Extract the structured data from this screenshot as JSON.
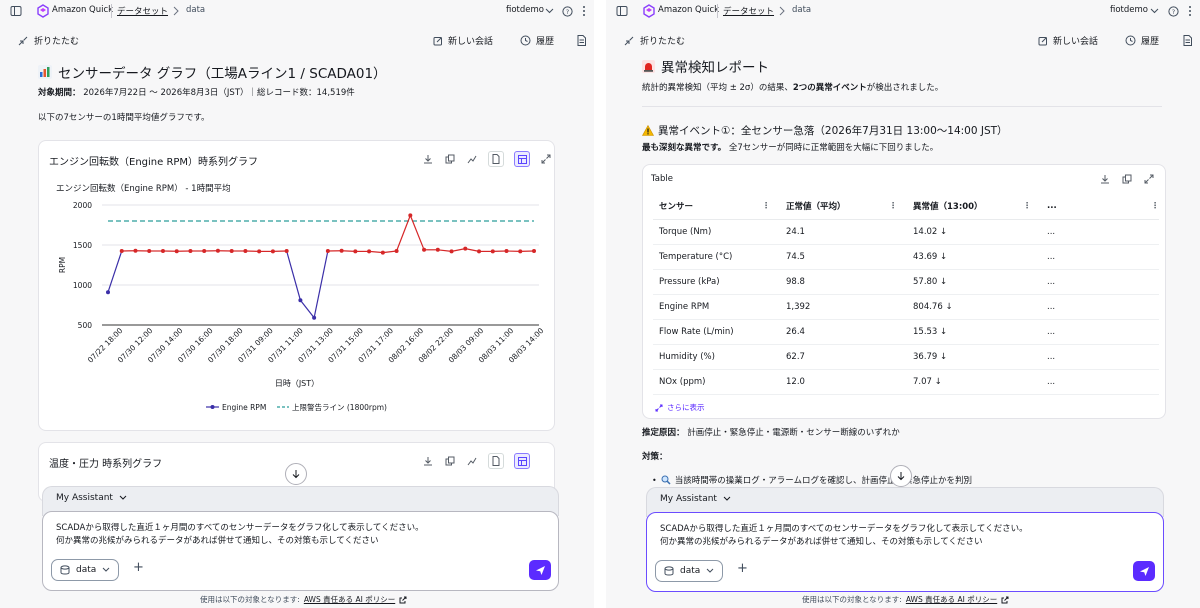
{
  "topbar": {
    "app_name": "Amazon Quick",
    "breadcrumb_dataset": "データセット",
    "breadcrumb_data": "data",
    "user": "fiotdemo"
  },
  "actions": {
    "collapse": "折りたたむ",
    "new_chat": "新しい会話",
    "history": "履歴"
  },
  "left": {
    "heading": "センサーデータ グラフ（工場Aライン1 / SCADA01）",
    "period_label": "対象期間：",
    "period_value": " 2026年7月22日 〜 2026年8月3日（JST）｜総レコード数：14,519件",
    "intro": "以下の7センサーの1時間平均値グラフです。",
    "card1_title": "エンジン回転数（Engine RPM）時系列グラフ",
    "card2_title": "温度・圧力 時系列グラフ"
  },
  "chart_data": {
    "type": "line",
    "title": "エンジン回転数（Engine RPM） - 1時間平均",
    "xlabel": "日時（JST）",
    "ylabel": "RPM",
    "ylim": [
      500,
      2000
    ],
    "yticks": [
      500,
      1000,
      1500,
      2000
    ],
    "xticks": [
      "07/22 18:00",
      "07/30 12:00",
      "07/30 14:00",
      "07/30 16:00",
      "07/30 18:00",
      "07/31 09:00",
      "07/31 11:00",
      "07/31 13:00",
      "07/31 15:00",
      "07/31 17:00",
      "08/02 16:00",
      "08/02 22:00",
      "08/03 09:00",
      "08/03 11:00",
      "08/03 14:00"
    ],
    "series": [
      {
        "name": "Engine RPM",
        "color": "#d62728",
        "values": [
          910,
          1425,
          1428,
          1425,
          1425,
          1422,
          1425,
          1425,
          1428,
          1425,
          1425,
          1420,
          1420,
          1425,
          810,
          590,
          1425,
          1428,
          1420,
          1420,
          1405,
          1425,
          1870,
          1440,
          1440,
          1420,
          1455,
          1420,
          1420,
          1425,
          1420,
          1425
        ]
      },
      {
        "name": "上限警告ライン (1800rpm)",
        "color": "#2a9d9b",
        "values": [
          1800
        ]
      }
    ],
    "anomaly_color": "#3b2fa8",
    "grid": true,
    "legend": "bottom"
  },
  "right": {
    "heading": "異常検知レポート",
    "summary_pre": "統計的異常検知（平均 ± 2σ）の結果、",
    "summary_bold": "2つの異常イベント",
    "summary_post": "が検出されました。",
    "event_title": "異常イベント①：全センサー急落（2026年7月31日 13:00〜14:00 JST）",
    "event_bold": "最も深刻な異常です。",
    "event_text": " 全7センサーが同時に正常範囲を大幅に下回りました。",
    "table_title": "Table",
    "columns": [
      "センサー",
      "正常値（平均）",
      "異常値（13:00）",
      "..."
    ],
    "rows": [
      [
        "Torque (Nm)",
        "24.1",
        "14.02 ↓",
        "..."
      ],
      [
        "Temperature (°C)",
        "74.5",
        "43.69 ↓",
        "..."
      ],
      [
        "Pressure (kPa)",
        "98.8",
        "57.80 ↓",
        "..."
      ],
      [
        "Engine RPM",
        "1,392",
        "804.76 ↓",
        "..."
      ],
      [
        "Flow Rate (L/min)",
        "26.4",
        "15.53 ↓",
        "..."
      ],
      [
        "Humidity (%)",
        "62.7",
        "36.79 ↓",
        "..."
      ],
      [
        "NOx (ppm)",
        "12.0",
        "7.07 ↓",
        "..."
      ]
    ],
    "show_more": "さらに表示",
    "cause_label": "推定原因：",
    "cause_text": " 計画停止・緊急停止・電源断・センサー断線のいずれか",
    "measures_label": "対策：",
    "measure1": "当該時間帯の操業ログ・アラームログを確認し、計画停止か緊急停止かを判別"
  },
  "composer": {
    "assistant": "My Assistant",
    "prompt_line1": "SCADAから取得した直近１ヶ月間のすべてのセンサーデータをグラフ化して表示してください。",
    "prompt_line2": "何か異常の兆候がみられるデータがあれば併せて通知し、その対策も示してください",
    "data_label": "data",
    "footer_text": "使用は以下の対象となります:",
    "footer_link": "AWS 責任ある AI ポリシー"
  }
}
